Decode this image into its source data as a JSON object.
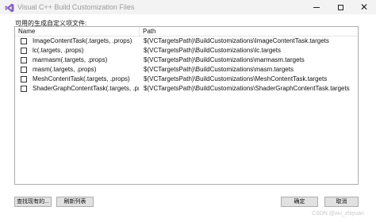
{
  "window": {
    "title": "Visual C++ Build Customization Files",
    "icon": "visual-studio-icon",
    "controls": {
      "minimize": "minimize-icon",
      "maximize": "maximize-icon",
      "close": "close-icon"
    }
  },
  "caption": "可用的生成自定义项文件:",
  "columns": {
    "name": "Name",
    "path": "Path"
  },
  "rows": [
    {
      "checked": false,
      "name": "ImageContentTask(.targets, .props)",
      "path": "$(VCTargetsPath)\\BuildCustomizations\\ImageContentTask.targets"
    },
    {
      "checked": false,
      "name": "lc(.targets, .props)",
      "path": "$(VCTargetsPath)\\BuildCustomizations\\lc.targets"
    },
    {
      "checked": false,
      "name": "marmasm(.targets, .props)",
      "path": "$(VCTargetsPath)\\BuildCustomizations\\marmasm.targets"
    },
    {
      "checked": false,
      "name": "masm(.targets, .props)",
      "path": "$(VCTargetsPath)\\BuildCustomizations\\masm.targets"
    },
    {
      "checked": false,
      "name": "MeshContentTask(.targets, .props)",
      "path": "$(VCTargetsPath)\\BuildCustomizations\\MeshContentTask.targets"
    },
    {
      "checked": false,
      "name": "ShaderGraphContentTask(.targets, .props)",
      "path": "$(VCTargetsPath)\\BuildCustomizations\\ShaderGraphContentTask.targets"
    }
  ],
  "buttons": {
    "find_existing": "查找现有的...",
    "refresh_list": "刷新列表",
    "ok": "确定",
    "cancel": "取消"
  },
  "watermark": "CSDN @wu_zhiyuan",
  "colors": {
    "title_text": "#9a9a9a",
    "button_face": "#e1e1e1",
    "vs_purple": "#865fc5"
  }
}
